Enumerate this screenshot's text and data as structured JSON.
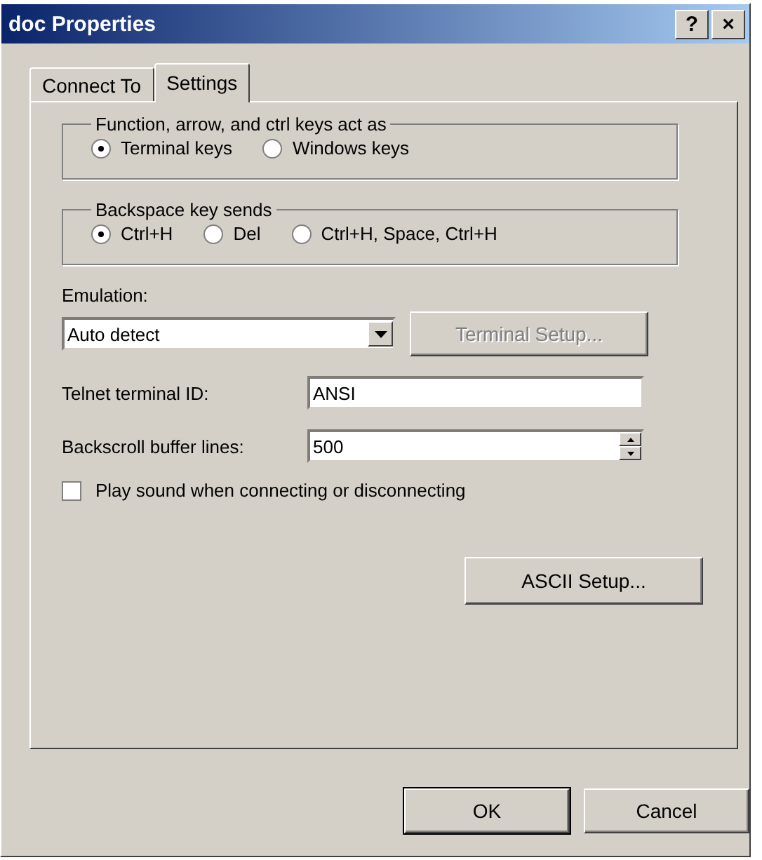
{
  "window": {
    "title": "doc Properties",
    "help_button": "?",
    "close_button": "×"
  },
  "tabs": [
    {
      "label": "Connect To",
      "selected": false
    },
    {
      "label": "Settings",
      "selected": true
    }
  ],
  "groups": [
    {
      "title": "Function, arrow, and ctrl keys act as",
      "options": [
        {
          "label": "Terminal keys",
          "selected": true
        },
        {
          "label": "Windows keys",
          "selected": false
        }
      ]
    },
    {
      "title": "Backspace key sends",
      "options": [
        {
          "label": "Ctrl+H",
          "selected": true
        },
        {
          "label": "Del",
          "selected": false
        },
        {
          "label": "Ctrl+H, Space, Ctrl+H",
          "selected": false
        }
      ]
    }
  ],
  "emulation": {
    "label": "Emulation:",
    "value": "Auto detect",
    "setup_button": {
      "label": "Terminal Setup...",
      "disabled": true
    }
  },
  "telnet_id": {
    "label": "Telnet terminal ID:",
    "value": "ANSI"
  },
  "backscroll": {
    "label": "Backscroll buffer lines:",
    "value": "500"
  },
  "play_sound": {
    "label": "Play sound when connecting or disconnecting",
    "checked": false
  },
  "ascii_button": {
    "label": "ASCII Setup..."
  },
  "buttons": [
    {
      "label": "OK",
      "default": true
    },
    {
      "label": "Cancel",
      "default": false
    }
  ]
}
